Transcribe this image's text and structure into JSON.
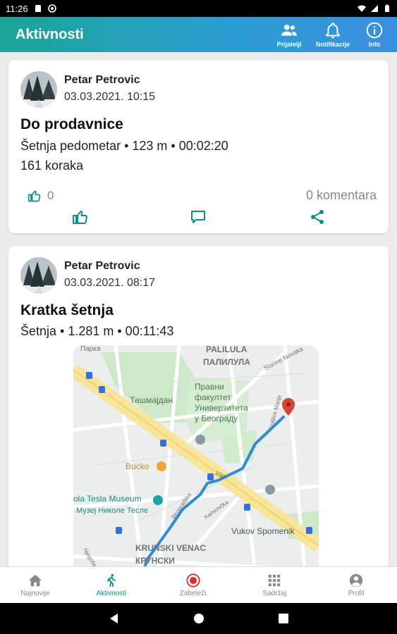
{
  "status_bar": {
    "time": "11:26"
  },
  "app_bar": {
    "title": "Aktivnosti",
    "actions": [
      {
        "label": "Prijatelji",
        "icon": "people-icon"
      },
      {
        "label": "Notifikacije",
        "icon": "bell-icon"
      },
      {
        "label": "Info",
        "icon": "info-icon"
      }
    ]
  },
  "feed": [
    {
      "author": "Petar Petrovic",
      "date": "03.03.2021. 10:15",
      "title": "Do prodavnice",
      "detail": "Šetnja pedometar • 123 m • 00:02:20",
      "extra": "161 koraka",
      "likes": "0",
      "comments": "0 komentara"
    },
    {
      "author": "Petar Petrovic",
      "date": "03.03.2021. 08:17",
      "title": "Kratka šetnja",
      "detail": "Šetnja • 1.281 m • 00:11:43",
      "map_labels": {
        "palilula": "PALILULA",
        "palilula_cyr": "ПАЛИЛУЛА",
        "starine_novaka": "Starine Novaka",
        "tasmajdan": "Ташмајдан",
        "pravni1": "Правни",
        "pravni2": "факултет",
        "pravni3": "Универзитета",
        "pravni4": "у Београду",
        "kraljice_marije": "Kraljice Marije",
        "bucko": "Bucko",
        "road_number": "100",
        "tesla1": "ola Tesla Museum",
        "tesla2": "Музеј Николе Тесле",
        "vukov": "Vukov Spomenik",
        "krunski1": "KRUNSKI VENAC",
        "krunski2": "КРУНСКИ",
        "kamenicka": "Kamenička",
        "beogradska": "Beogradska",
        "njegoseva": "Njegoševa",
        "top_clip": "Парка"
      }
    }
  ],
  "bottom_nav": [
    {
      "label": "Najnovije",
      "icon": "home-icon"
    },
    {
      "label": "Aktivnosti",
      "icon": "walking-icon",
      "active": true
    },
    {
      "label": "Zabeleži",
      "icon": "record-icon"
    },
    {
      "label": "Sadržaj",
      "icon": "grid-icon"
    },
    {
      "label": "Profil",
      "icon": "profile-icon"
    }
  ],
  "colors": {
    "accent": "#0e8f82",
    "record": "#d9332c",
    "route": "#1e88d8"
  }
}
